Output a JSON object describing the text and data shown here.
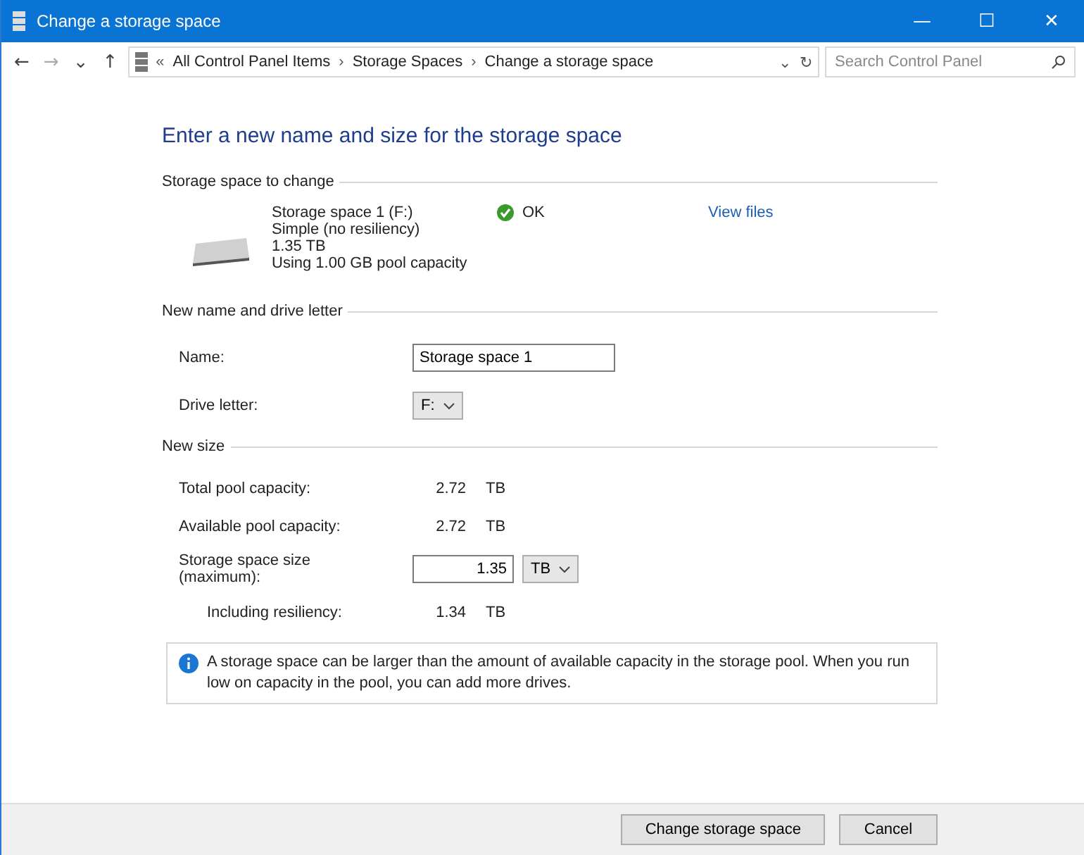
{
  "window": {
    "title": "Change a storage space",
    "controls": [
      "—",
      "☐",
      "✕"
    ]
  },
  "address_bar": {
    "back": "←",
    "forward": "→",
    "recent": "⌄",
    "up": "↑",
    "overflow": "«",
    "crumbs": [
      "All Control Panel Items",
      "Storage Spaces",
      "Change a storage space"
    ],
    "separator": "›",
    "dropdown": "⌄",
    "refresh": "↻"
  },
  "search": {
    "placeholder": "Search Control Panel"
  },
  "heading": "Enter a new name and size for the storage space",
  "storage_section": {
    "title": "Storage space to change",
    "details": [
      "Storage space 1 (F:)",
      "Simple (no resiliency)",
      "1.35 TB",
      "Using 1.00 GB pool capacity"
    ],
    "status": "OK",
    "link": "View files"
  },
  "name_section": {
    "title": "New name and drive letter",
    "name_label": "Name:",
    "name_value": "Storage space 1",
    "drive_label": "Drive letter:",
    "drive_value": "F:"
  },
  "size_section": {
    "title": "New size",
    "rows": [
      {
        "kind": "info",
        "label": "Total pool capacity:",
        "value": "2.72",
        "unit": "TB"
      },
      {
        "kind": "info",
        "label": "Available pool capacity:",
        "value": "2.72",
        "unit": "TB"
      },
      {
        "kind": "input",
        "label": "Storage space size (maximum):",
        "value": "1.35",
        "unit": "TB"
      },
      {
        "kind": "sub",
        "label": "Including resiliency:",
        "value": "1.34",
        "unit": "TB"
      }
    ]
  },
  "info_note": "A storage space can be larger than the amount of available capacity in the storage pool. When you run low on capacity in the pool, you can add more drives.",
  "buttons": [
    "Change storage space",
    "Cancel"
  ]
}
